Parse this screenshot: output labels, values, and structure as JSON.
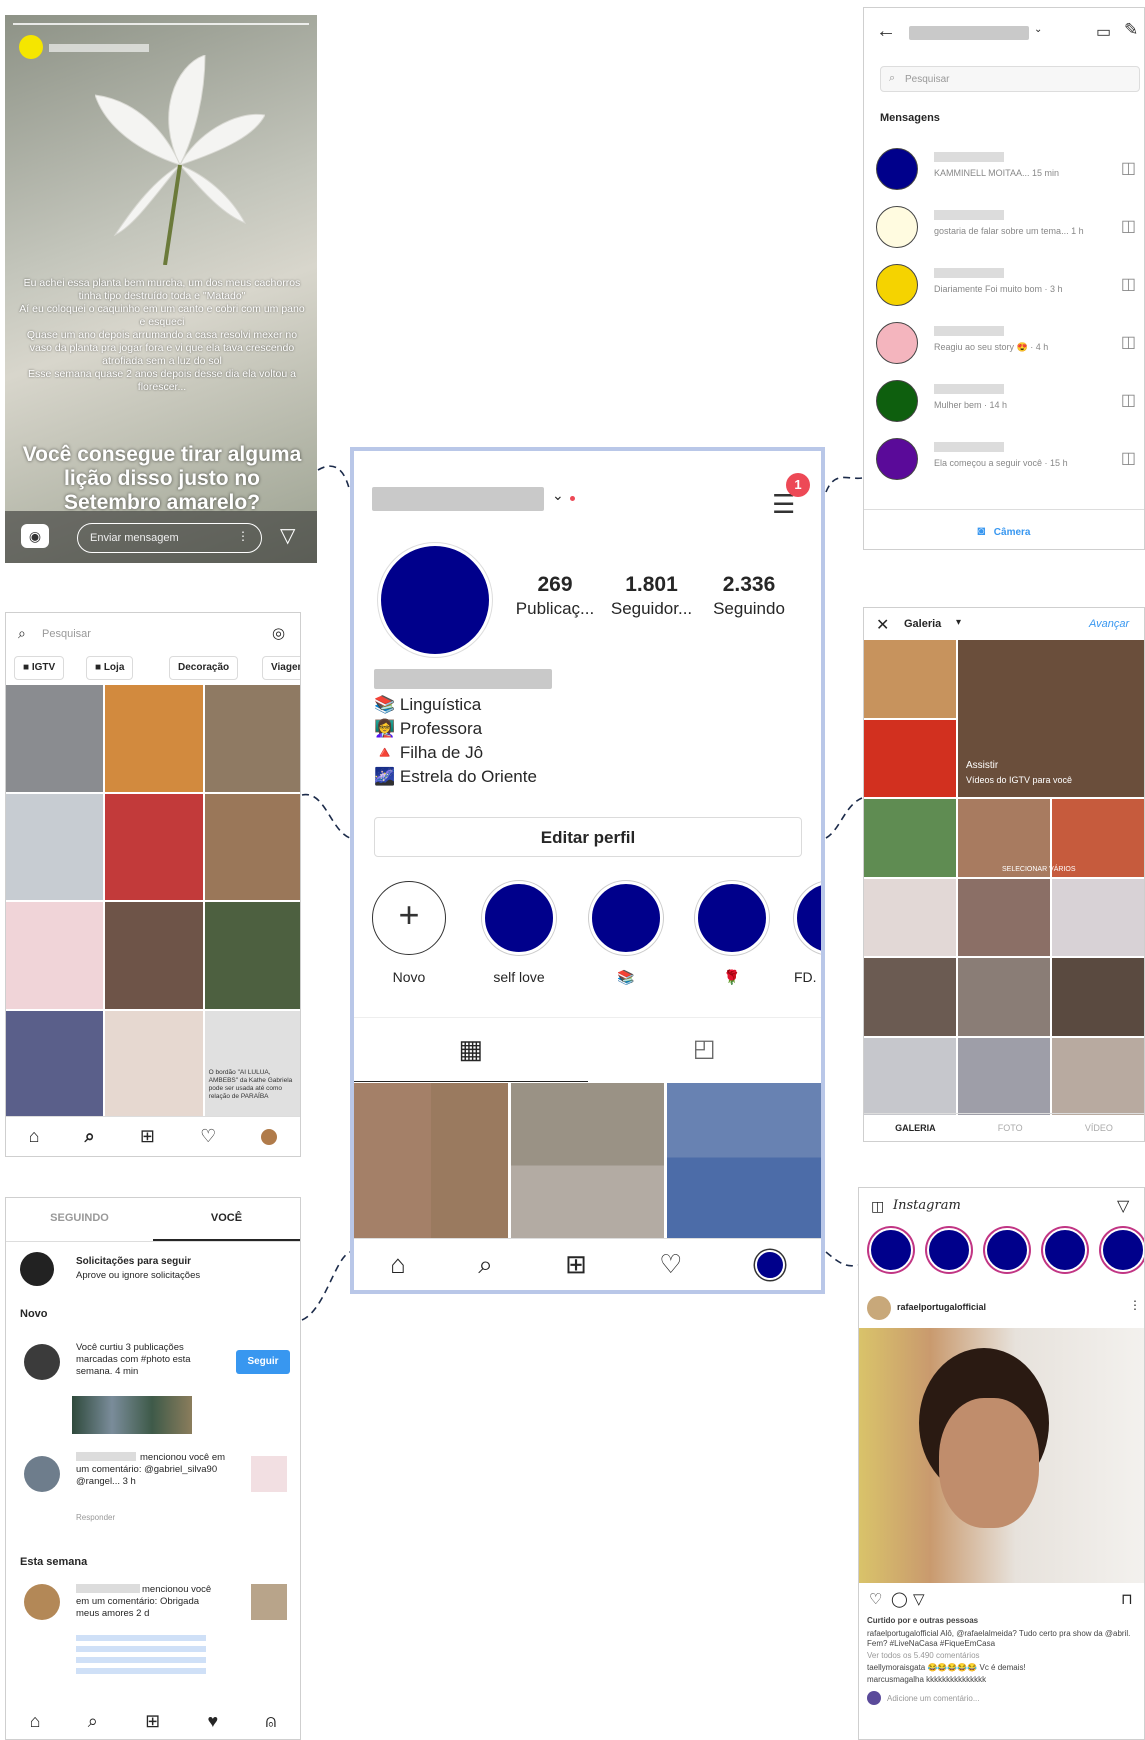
{
  "story": {
    "body_text": "Eu achei essa planta bem murcha, um dos meus cachorros tinha tipo destruído toda e \"Matado\"\nAí eu coloquei o caquinho em um canto e cobri com um pano e esqueci\nQuase um ano depois arrumando a casa resolvi mexer no vaso da planta pra jogar fora e vi que ela tava crescendo atrofiada sem a luz do sol\nEsse semana quase 2 anos depois desse dia ela voltou a florescer...",
    "question": "Você consegue tirar alguma lição disso justo no Setembro amarelo?",
    "message_placeholder": "Enviar mensagem",
    "camera_icon": "camera-icon",
    "send_icon": "send-icon"
  },
  "messages": {
    "search_placeholder": "Pesquisar",
    "section_title": "Mensagens",
    "camera_label": "Câmera",
    "threads": [
      {
        "preview": "KAMMINELL MOITAA... 15 min",
        "color": "#00008b"
      },
      {
        "preview": "gostaria de falar sobre um tema... 1 h",
        "color": "#fffbe0"
      },
      {
        "preview": "Diariamente Foi muito bom · 3 h",
        "color": "#f5d300"
      },
      {
        "preview": "Reagiu ao seu story 😍 · 4 h",
        "color": "#f4b5be"
      },
      {
        "preview": "Mulher bem · 14 h",
        "color": "#0e5f0e"
      },
      {
        "preview": "Ela começou a seguir você · 15 h",
        "color": "#5a0a99"
      }
    ]
  },
  "explore": {
    "search_placeholder": "Pesquisar",
    "chips": [
      "IGTV",
      "Loja",
      "Decoração",
      "Viagem"
    ],
    "post_caption": "O bordão \"AI LULUA, AMBEBS\" da Kathe Gabriela pode ser usada até como relação de PARAÍBA"
  },
  "activity": {
    "tab_following": "SEGUINDO",
    "tab_you": "VOCÊ",
    "requests_title": "Solicitações para seguir",
    "requests_sub": "Aprove ou ignore solicitações",
    "section_new": "Novo",
    "item1_text": "Você curtiu 3 publicações marcadas com #photo esta semana. 4 min",
    "follow_label": "Seguir",
    "item2_text": "mencionou você em um comentário: @gabriel_silva90 @rangel... 3 h",
    "reply_label": "Responder",
    "section_week": "Esta semana",
    "item3_text": "mencionou você em um comentário: Obrigada meus amores 2 d"
  },
  "profile": {
    "notification_count": "1",
    "stats": [
      {
        "value": "269",
        "label": "Publicaç..."
      },
      {
        "value": "1.801",
        "label": "Seguidor..."
      },
      {
        "value": "2.336",
        "label": "Seguindo"
      }
    ],
    "bio": [
      "📚 Linguística",
      "👩‍🏫 Professora",
      "🔺 Filha de Jô",
      "🌌 Estrela do Oriente"
    ],
    "edit_button": "Editar perfil",
    "highlights": [
      {
        "label": "Novo"
      },
      {
        "label": "self love"
      },
      {
        "label": "📚"
      },
      {
        "label": "🌹"
      },
      {
        "label": "FD."
      }
    ]
  },
  "gallery": {
    "title": "Galeria",
    "next_label": "Avançar",
    "watch_label": "Assistir",
    "igtv_label": "Vídeos do IGTV para você",
    "select_label": "SELECIONAR VÁRIOS",
    "footer_tabs": [
      "GALERIA",
      "FOTO",
      "VÍDEO"
    ]
  },
  "feed": {
    "logo": "Instagram",
    "post_user": "rafaelportugalofficial",
    "likes_text": "Curtido por  e outras pessoas",
    "caption": "rafaelportugalofficial Alô, @rafaelalmeida? Tudo certo pra show da @abril. Fem? #LiveNaCasa #FiqueEmCasa",
    "comments_link": "Ver todos os 5.490 comentários",
    "comment1": "taellymoraisgata 😂😂😂😂😂 Vc é demais!",
    "comment2": "marcusmagalha kkkkkkkkkkkkkkk",
    "add_comment": "Adicione um comentário..."
  }
}
